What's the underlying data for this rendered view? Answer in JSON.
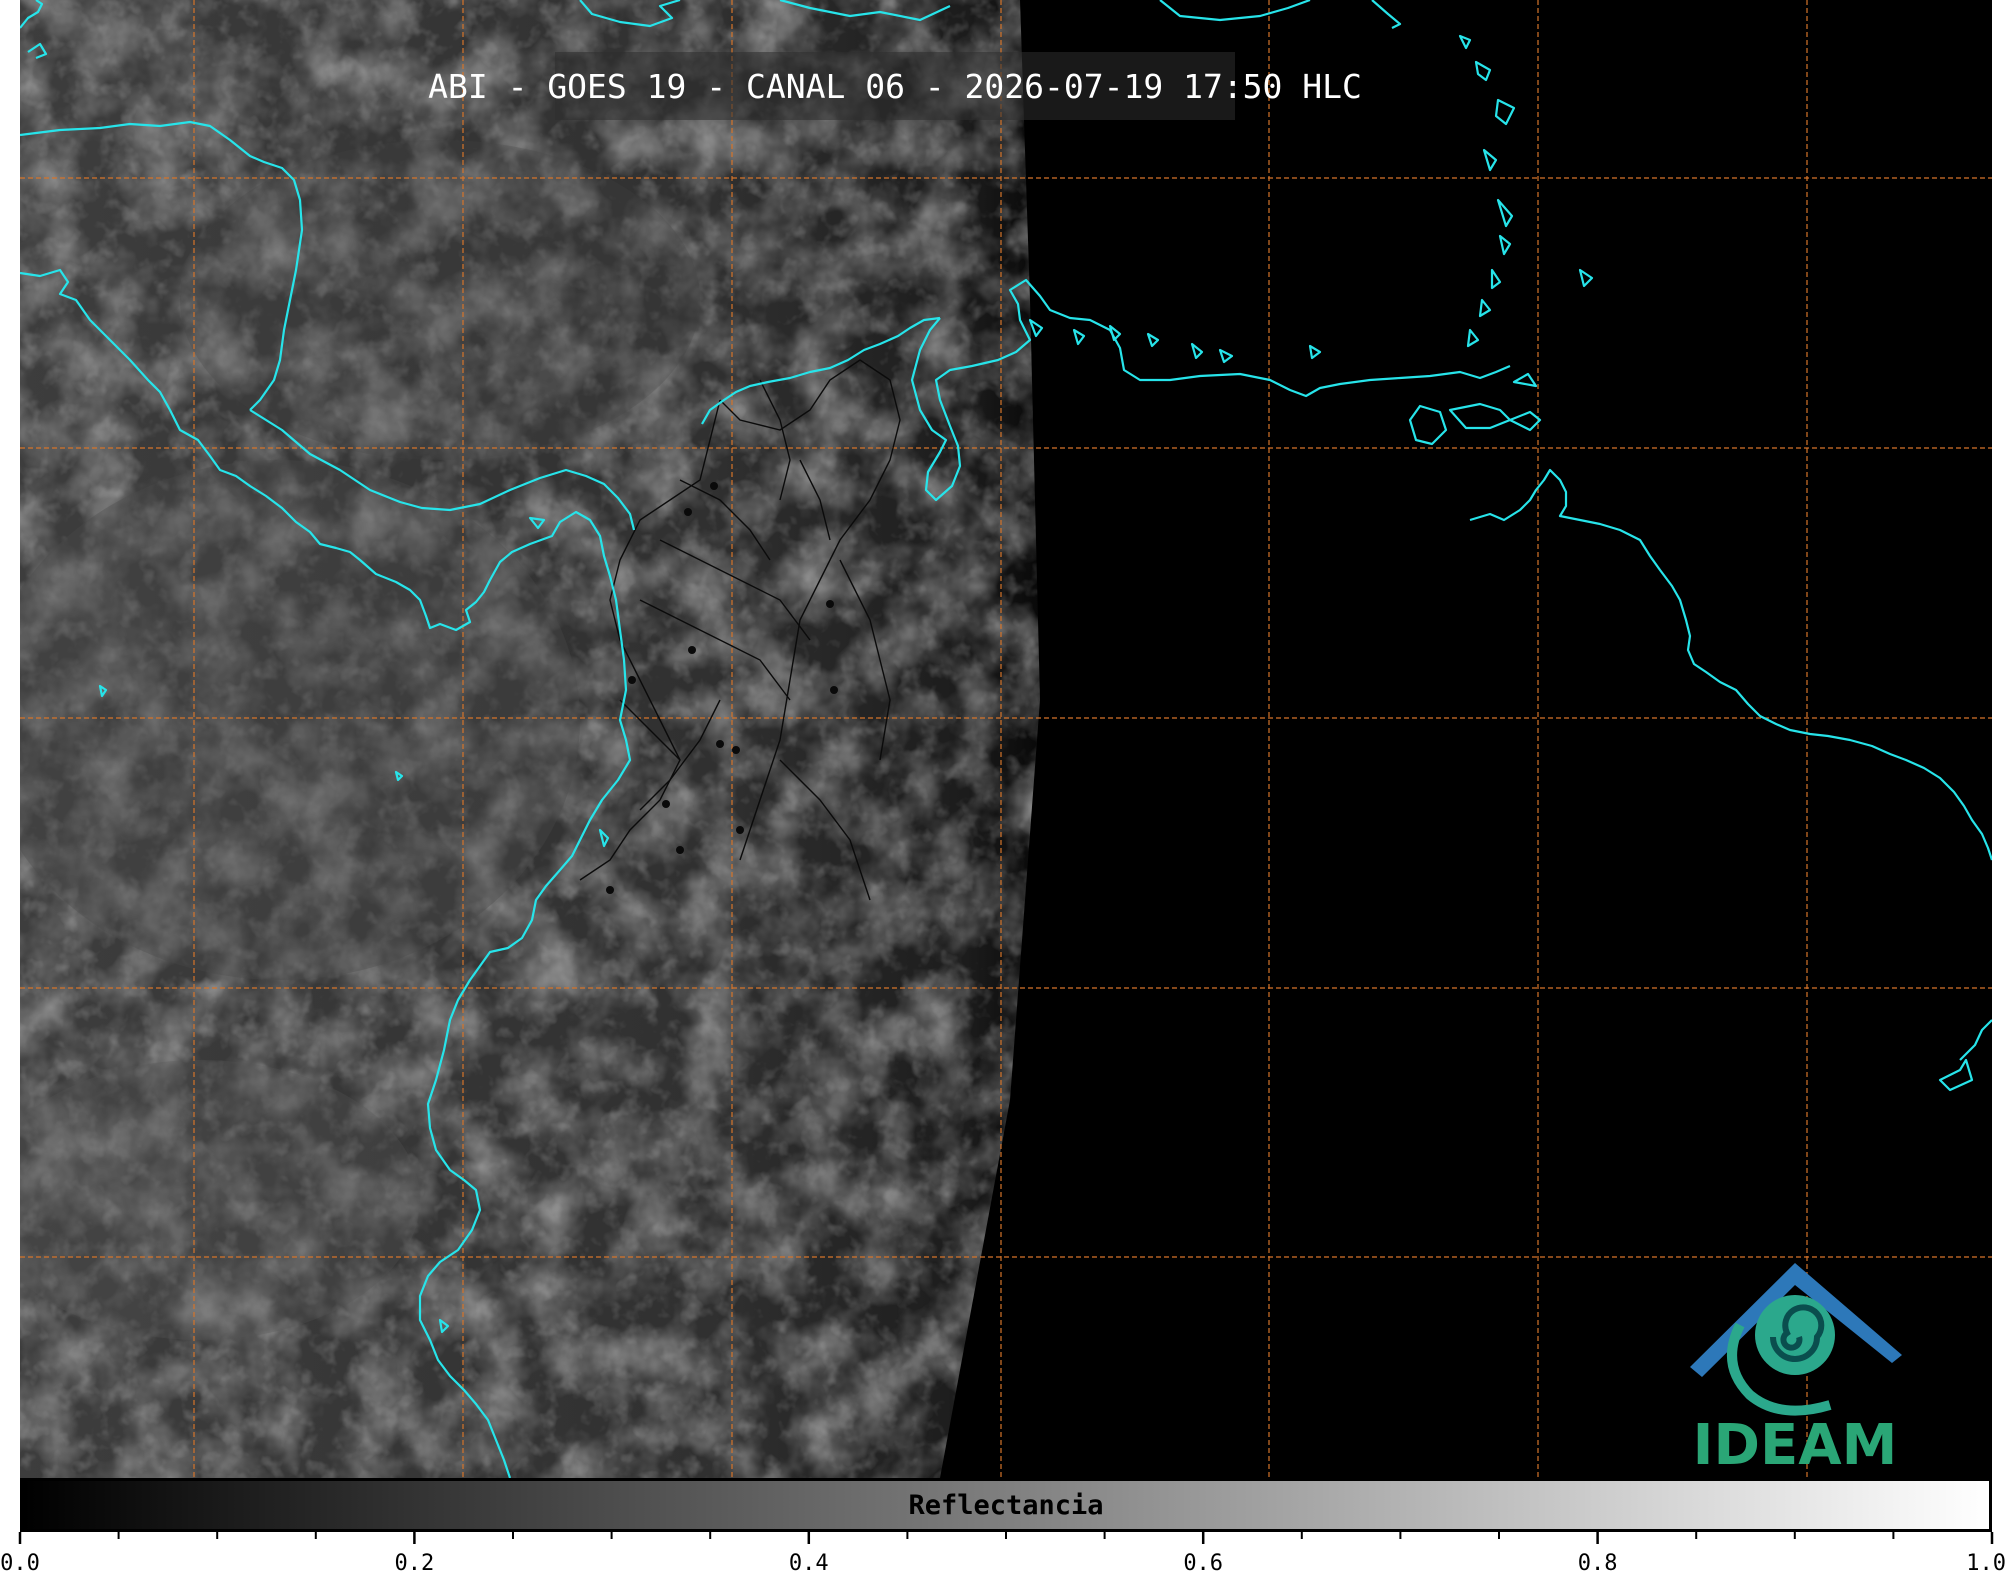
{
  "title": "ABI - GOES 19 - CANAL 06 - 2026-07-19 17:50 HLC",
  "map": {
    "background_color": "#000000",
    "cloud_color": "#3a3a3a",
    "coastline_color": "#27e4ea",
    "border_color": "#0a0a0a",
    "gridline_color": "#d5742a"
  },
  "colorbar": {
    "label": "Reflectancia",
    "colormap": [
      "#000000",
      "#ffffff"
    ],
    "range": [
      0.0,
      1.0
    ],
    "tick_labels": [
      "0.0",
      "0.2",
      "0.4",
      "0.6",
      "0.8",
      "1.0"
    ],
    "tick_values": [
      0.0,
      0.2,
      0.4,
      0.6,
      0.8,
      1.0
    ],
    "minor_tick_step": 0.05
  },
  "logo": {
    "text": "IDEAM",
    "text_color": "#2aa676",
    "roof_color": "#2d78b9",
    "swirl_color": "#2ba88c"
  }
}
